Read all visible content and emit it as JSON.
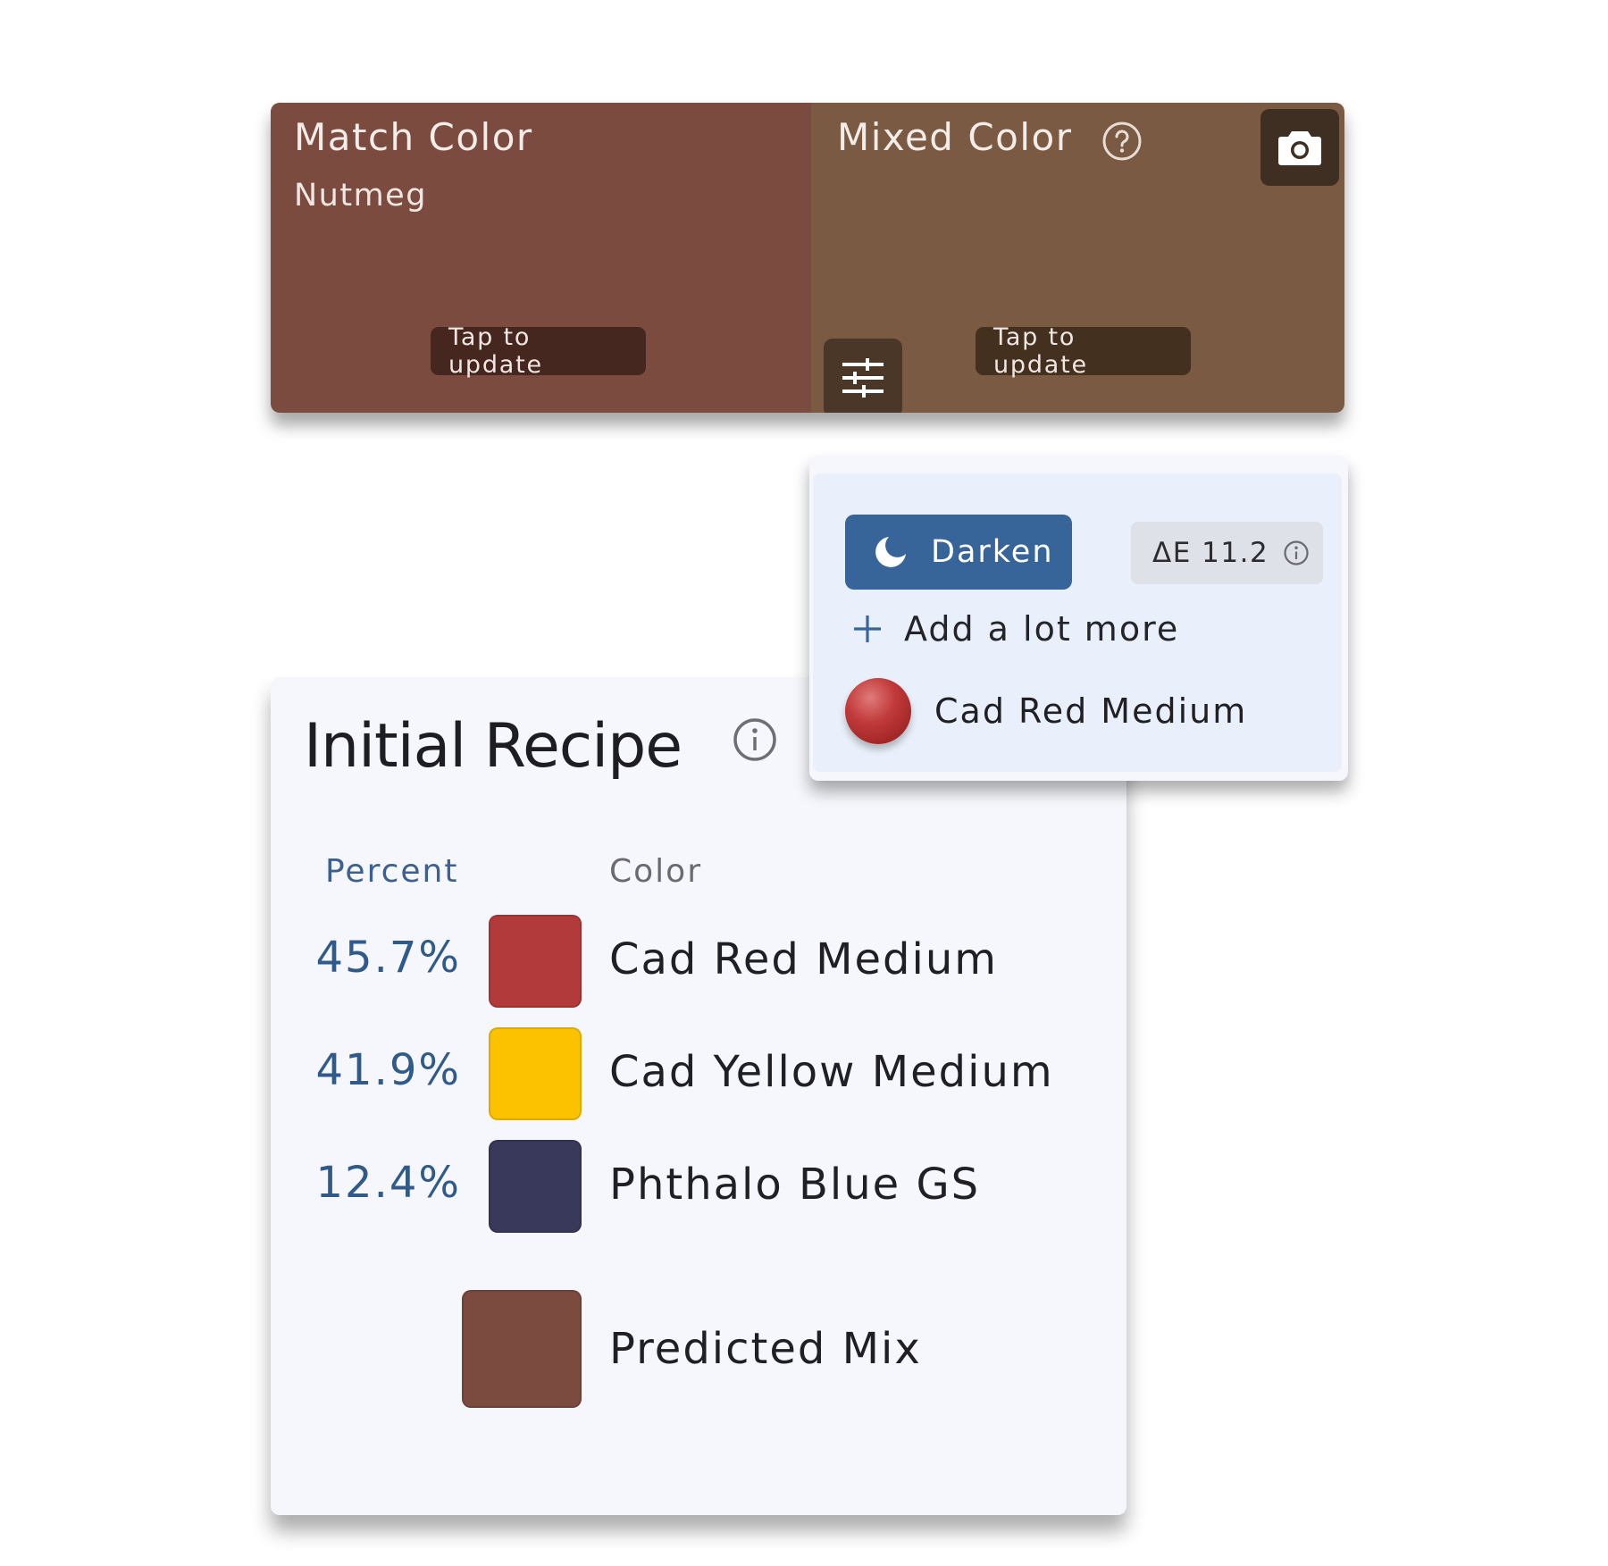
{
  "header": {
    "match": {
      "title": "Match Color",
      "name": "Nutmeg",
      "tap_label": "Tap to update",
      "color": "#7c4b3f"
    },
    "mixed": {
      "title": "Mixed Color",
      "tap_label": "Tap to update",
      "color": "#7a5a42"
    }
  },
  "adjustment": {
    "darken_label": "Darken",
    "delta_e_label": "ΔE 11.2",
    "add_label": "Add a lot more",
    "paint_name": "Cad Red Medium",
    "paint_color": "#b33a3a"
  },
  "recipe": {
    "title": "Initial Recipe",
    "col_percent": "Percent",
    "col_color": "Color",
    "rows": [
      {
        "percent": "45.7%",
        "name": "Cad Red Medium",
        "color": "#b33a3a"
      },
      {
        "percent": "41.9%",
        "name": "Cad Yellow Medium",
        "color": "#fcc200"
      },
      {
        "percent": "12.4%",
        "name": "Phthalo Blue GS",
        "color": "#393a5b"
      }
    ],
    "predicted_label": "Predicted Mix",
    "predicted_color": "#7c4b3f"
  }
}
